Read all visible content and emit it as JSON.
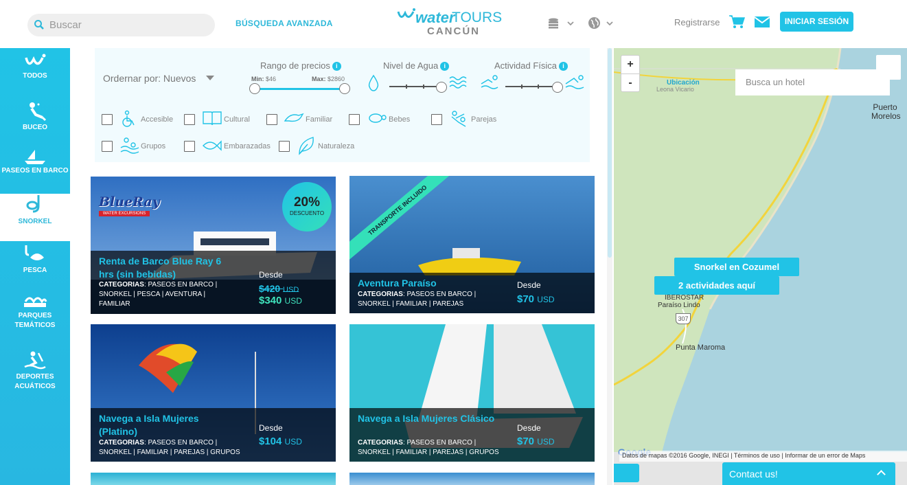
{
  "header": {
    "search_placeholder": "Buscar",
    "advanced_search": "BÚSQUEDA AVANZADA",
    "logo_water": "water",
    "logo_tours": "TOURS",
    "logo_city": "CANCÚN",
    "register": "Registrarse",
    "login": "INICIAR SESIÓN"
  },
  "sidebar": {
    "items": [
      {
        "label": "TODOS",
        "icon": "water-logo-icon"
      },
      {
        "label": "BUCEO",
        "icon": "diver-icon"
      },
      {
        "label": "PASEOS EN BARCO",
        "icon": "boat-icon"
      },
      {
        "label": "SNORKEL",
        "icon": "snorkel-icon"
      },
      {
        "label": "PESCA",
        "icon": "fishing-icon"
      },
      {
        "label": "PARQUES TEMÁTICOS",
        "icon": "park-icon"
      },
      {
        "label": "DEPORTES ACUÁTICOS",
        "icon": "watersport-icon"
      }
    ],
    "active_index": 3
  },
  "filters": {
    "order_label": "Ordernar por: Nuevos",
    "price_label": "Rango de precios",
    "price_min_label": "Min:",
    "price_min": "$46",
    "price_max_label": "Max:",
    "price_max": "$2860",
    "water_label": "Nivel de Agua",
    "activity_label": "Actividad Física",
    "checkboxes": [
      "Accesible",
      "Cultural",
      "Familiar",
      "Bebes",
      "Parejas",
      "Grupos",
      "Embarazadas",
      "Naturaleza"
    ]
  },
  "cards": [
    {
      "title": "Renta de Barco Blue Ray 6 hrs (sin bebidas)",
      "cats_label": "CATEGORIAS",
      "cats": ": PASEOS EN BARCO | SNORKEL | PESCA | AVENTURA | FAMILIAR",
      "desde": "Desde",
      "old_price": "$420",
      "price": "$340",
      "currency": "USD",
      "badge_pct": "20%",
      "badge_text": "DESCUENTO",
      "brand": "BlueRay",
      "brand_sub": "WATER EXCURSIONS"
    },
    {
      "title": "Aventura Paraíso",
      "cats_label": "CATEGORIAS",
      "cats": ": PASEOS EN BARCO | SNORKEL | FAMILIAR | PAREJAS",
      "desde": "Desde",
      "price": "$70",
      "currency": "USD",
      "ribbon": "TRANSPORTE INCLUIDO"
    },
    {
      "title": "Navega a Isla Mujeres (Platino)",
      "cats_label": "CATEGORIAS",
      "cats": ": PASEOS EN BARCO | SNORKEL | FAMILIAR | PAREJAS | GRUPOS",
      "desde": "Desde",
      "price": "$104",
      "currency": "USD"
    },
    {
      "title": "Navega a Isla Mujeres Clásico",
      "cats_label": "CATEGORIAS",
      "cats": ": PASEOS EN BARCO | SNORKEL | FAMILIAR | PAREJAS | GRUPOS",
      "desde": "Desde",
      "price": "$70",
      "currency": "USD"
    }
  ],
  "map": {
    "zoom_in": "+",
    "zoom_out": "-",
    "hotel_placeholder": "Busca un hotel",
    "ubicacion": "Ubicación",
    "place_leona": "Leona Vicario",
    "place_puerto": "Puerto Morelos",
    "place_iberostar": "IBEROSTAR",
    "place_paraiso": "Paraíso Lindo",
    "place_maroma": "Punta Maroma",
    "road_307": "307",
    "tip1": "Snorkel en Cozumel",
    "tip2": "2 actividades aquí",
    "attribution": "Datos de mapas ©2016 Google, INEGI",
    "terms": "Términos de uso",
    "report": "Informar de un error de Maps",
    "google": "Google"
  },
  "contact": "Contact us!"
}
